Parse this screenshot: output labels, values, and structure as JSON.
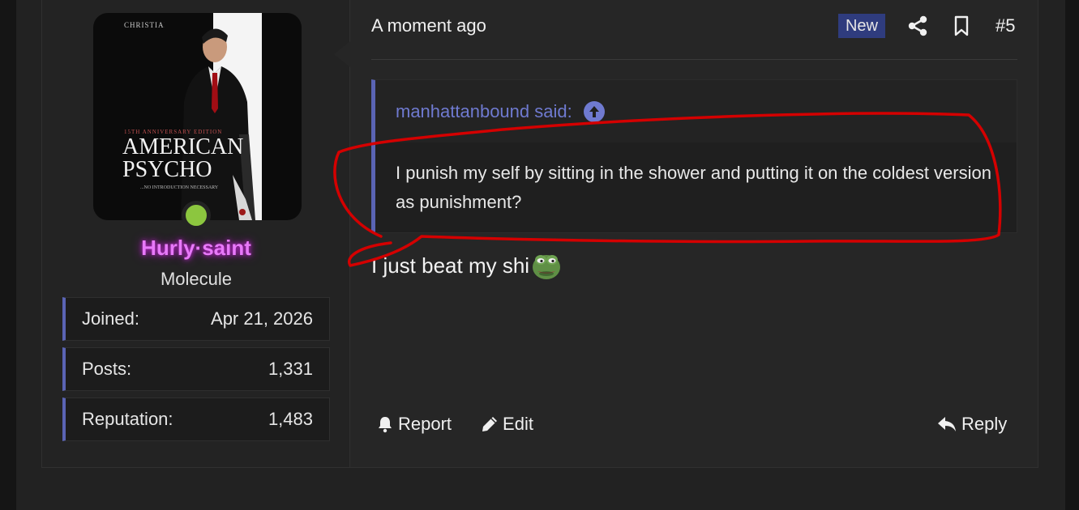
{
  "avatar": {
    "poster_credit": "CHRISTIAN BALE",
    "poster_anniversary": "15TH ANNIVERSARY EDITION",
    "poster_title_line1": "AMERICAN",
    "poster_title_line2": "PSYCHO",
    "poster_tagline": "...NO INTRODUCTION NECESSARY",
    "online_status_color": "#8cc63f"
  },
  "user": {
    "name": "Hurly·saint",
    "title": "Molecule",
    "stats": [
      {
        "label": "Joined:",
        "value": "Apr 21, 2026"
      },
      {
        "label": "Posts:",
        "value": "1,331"
      },
      {
        "label": "Reputation:",
        "value": "1,483"
      }
    ]
  },
  "post": {
    "timestamp": "A moment ago",
    "new_badge": "New",
    "share_icon": "share-icon",
    "bookmark_icon": "bookmark-icon",
    "number": "#5",
    "quote": {
      "author_line": "manhattanbound said:",
      "body": "I punish my self by sitting in the shower and putting it on the coldest version as punishment?"
    },
    "message": "I just beat my shi",
    "emoji": "pepe-emoji"
  },
  "actions": {
    "report": "Report",
    "edit": "Edit",
    "reply": "Reply"
  },
  "colors": {
    "accent": "#5a64b4",
    "username": "#e879f9",
    "annotation": "#d40000"
  }
}
